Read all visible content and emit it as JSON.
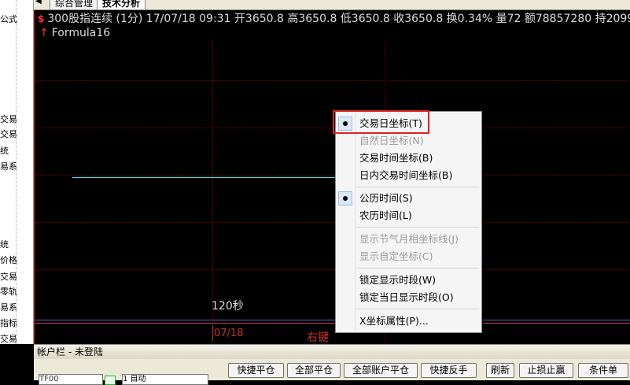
{
  "left_panel": {
    "labels": [
      "公式",
      "交易",
      "交易",
      "统",
      "易系",
      "统",
      "价格",
      "交易",
      "零轨",
      "易系",
      "指标",
      "交易",
      "率对",
      "指指"
    ]
  },
  "tabs": [
    {
      "label": "综合管理"
    },
    {
      "label": "技术分析"
    }
  ],
  "quote_bar": {
    "icon_glyph": "$",
    "text": "300股指连续 (1分) 17/07/18 09:31 开3650.8 高3650.8 低3650.8 收3650.8 换0.34% 量72 额78857280 持20996 振0.0"
  },
  "formula": {
    "icon_glyph": "↑",
    "label": "Formula16"
  },
  "chart": {
    "x_axis_label": "120秒",
    "date_label": "07/18",
    "annotation": "右键",
    "colors": {
      "grid": "#7a0000",
      "price": "#56d7d7"
    }
  },
  "context_menu": {
    "items": [
      {
        "label": "交易日坐标(T)",
        "checked": true,
        "enabled": true
      },
      {
        "label": "自然日坐标(N)",
        "checked": false,
        "enabled": false
      },
      {
        "label": "交易时间坐标(B)",
        "checked": false,
        "enabled": true
      },
      {
        "label": "日内交易时间坐标(B)",
        "checked": false,
        "enabled": true
      },
      {
        "label": "公历时间(S)",
        "checked": true,
        "enabled": true
      },
      {
        "label": "农历时间(L)",
        "checked": false,
        "enabled": true
      },
      {
        "label": "显示节气月相坐标线(J)",
        "checked": false,
        "enabled": false
      },
      {
        "label": "显示自定坐标(C)",
        "checked": false,
        "enabled": false
      },
      {
        "label": "锁定显示时段(W)",
        "checked": false,
        "enabled": true
      },
      {
        "label": "锁定当日显示时段(O)",
        "checked": false,
        "enabled": true
      },
      {
        "label": "X坐标属性(P)...",
        "checked": false,
        "enabled": true
      }
    ]
  },
  "account_panel": {
    "title": "帐户栏 - 未登陆",
    "input_value": "TF00",
    "spin_value": "1 自动",
    "buttons": [
      "快捷平仓",
      "全部平仓",
      "全部账户平仓",
      "快捷反手",
      "刷新",
      "止损止赢",
      "条件单"
    ]
  }
}
